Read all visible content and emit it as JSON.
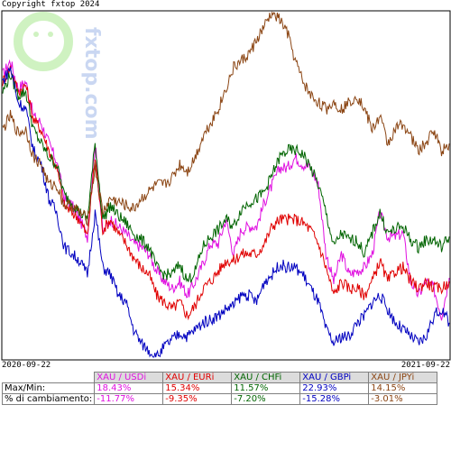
{
  "copyright": "Copyright fxtop 2024",
  "watermark": "fxtop.com",
  "chart_data": {
    "type": "line",
    "x_start": "2020-09-22",
    "x_end": "2021-09-22",
    "series": [
      {
        "name": "XAU / USD",
        "color": "#e010e0",
        "values": [
          0.82,
          0.86,
          0.78,
          0.8,
          0.7,
          0.68,
          0.62,
          0.57,
          0.46,
          0.44,
          0.4,
          0.35,
          0.62,
          0.36,
          0.4,
          0.38,
          0.36,
          0.33,
          0.32,
          0.3,
          0.25,
          0.22,
          0.2,
          0.22,
          0.18,
          0.22,
          0.27,
          0.33,
          0.33,
          0.4,
          0.3,
          0.37,
          0.38,
          0.38,
          0.45,
          0.5,
          0.55,
          0.55,
          0.58,
          0.56,
          0.55,
          0.5,
          0.3,
          0.22,
          0.3,
          0.24,
          0.25,
          0.26,
          0.3,
          0.42,
          0.35,
          0.35,
          0.36,
          0.22,
          0.18,
          0.22,
          0.2,
          0.12,
          0.23
        ]
      },
      {
        "name": "XAU / EUR",
        "color": "#e00000",
        "values": [
          0.8,
          0.84,
          0.77,
          0.79,
          0.69,
          0.66,
          0.6,
          0.55,
          0.44,
          0.42,
          0.4,
          0.35,
          0.58,
          0.37,
          0.4,
          0.36,
          0.33,
          0.29,
          0.26,
          0.24,
          0.18,
          0.16,
          0.14,
          0.16,
          0.12,
          0.15,
          0.2,
          0.22,
          0.25,
          0.28,
          0.28,
          0.3,
          0.3,
          0.3,
          0.33,
          0.38,
          0.4,
          0.4,
          0.4,
          0.39,
          0.37,
          0.33,
          0.26,
          0.18,
          0.22,
          0.2,
          0.2,
          0.18,
          0.22,
          0.28,
          0.22,
          0.25,
          0.26,
          0.22,
          0.2,
          0.22,
          0.2,
          0.2,
          0.22
        ]
      },
      {
        "name": "XAU / CHF",
        "color": "#006400",
        "values": [
          0.77,
          0.82,
          0.76,
          0.77,
          0.66,
          0.62,
          0.58,
          0.56,
          0.47,
          0.45,
          0.42,
          0.4,
          0.62,
          0.4,
          0.44,
          0.41,
          0.39,
          0.36,
          0.34,
          0.32,
          0.26,
          0.24,
          0.24,
          0.27,
          0.22,
          0.25,
          0.32,
          0.35,
          0.37,
          0.4,
          0.38,
          0.43,
          0.45,
          0.46,
          0.48,
          0.53,
          0.58,
          0.6,
          0.6,
          0.59,
          0.55,
          0.5,
          0.42,
          0.32,
          0.36,
          0.34,
          0.34,
          0.3,
          0.36,
          0.42,
          0.36,
          0.37,
          0.38,
          0.34,
          0.32,
          0.34,
          0.34,
          0.32,
          0.35
        ]
      },
      {
        "name": "XAU / GBP",
        "color": "#0000c0",
        "values": [
          0.8,
          0.84,
          0.74,
          0.72,
          0.6,
          0.56,
          0.46,
          0.42,
          0.32,
          0.3,
          0.28,
          0.24,
          0.42,
          0.26,
          0.24,
          0.18,
          0.16,
          0.08,
          0.04,
          0.02,
          0.0,
          0.03,
          0.05,
          0.07,
          0.06,
          0.08,
          0.1,
          0.11,
          0.12,
          0.14,
          0.15,
          0.18,
          0.18,
          0.16,
          0.22,
          0.24,
          0.27,
          0.26,
          0.26,
          0.24,
          0.2,
          0.16,
          0.08,
          0.04,
          0.06,
          0.06,
          0.1,
          0.12,
          0.16,
          0.18,
          0.14,
          0.1,
          0.08,
          0.06,
          0.04,
          0.06,
          0.12,
          0.14,
          0.1
        ]
      },
      {
        "name": "XAU / JPY",
        "color": "#8b4513",
        "values": [
          0.66,
          0.7,
          0.65,
          0.66,
          0.58,
          0.56,
          0.5,
          0.5,
          0.44,
          0.44,
          0.42,
          0.4,
          0.55,
          0.42,
          0.46,
          0.45,
          0.44,
          0.43,
          0.46,
          0.48,
          0.5,
          0.5,
          0.52,
          0.56,
          0.54,
          0.58,
          0.64,
          0.68,
          0.72,
          0.78,
          0.84,
          0.86,
          0.88,
          0.92,
          0.96,
          1.0,
          0.98,
          0.94,
          0.86,
          0.8,
          0.76,
          0.74,
          0.72,
          0.74,
          0.72,
          0.74,
          0.76,
          0.72,
          0.66,
          0.7,
          0.62,
          0.66,
          0.68,
          0.64,
          0.6,
          0.62,
          0.66,
          0.6,
          0.62
        ]
      }
    ]
  },
  "stats": {
    "row_maxmin_label": "Max/Min:",
    "row_change_label": "% di cambiamento:",
    "headers": [
      "XAU / USDi",
      "XAU / EURi",
      "XAU / CHFi",
      "XAU / GBPi",
      "XAU / JPYi"
    ],
    "maxmin": [
      "18.43%",
      "15.34%",
      "11.57%",
      "22.93%",
      "14.15%"
    ],
    "change": [
      "-11.77%",
      "-9.35%",
      "-7.20%",
      "-15.28%",
      "-3.01%"
    ]
  }
}
